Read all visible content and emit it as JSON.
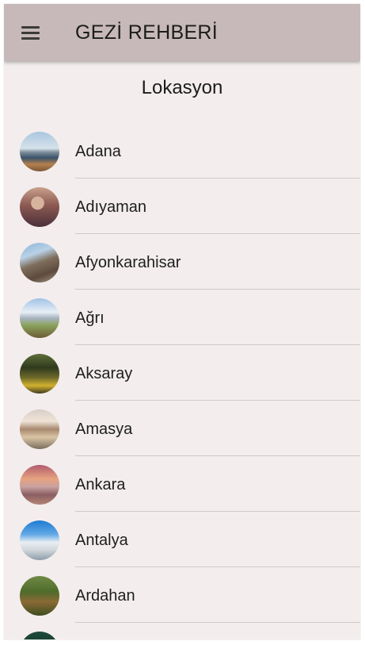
{
  "app": {
    "title": "GEZİ REHBERİ",
    "menu_icon": "hamburger-menu-icon"
  },
  "page": {
    "section_title": "Lokasyon"
  },
  "locations": [
    {
      "label": "Adana",
      "thumb": "adana-thumbnail"
    },
    {
      "label": "Adıyaman",
      "thumb": "adiyaman-thumbnail"
    },
    {
      "label": "Afyonkarahisar",
      "thumb": "afyonkarahisar-thumbnail"
    },
    {
      "label": "Ağrı",
      "thumb": "agri-thumbnail"
    },
    {
      "label": "Aksaray",
      "thumb": "aksaray-thumbnail"
    },
    {
      "label": "Amasya",
      "thumb": "amasya-thumbnail"
    },
    {
      "label": "Ankara",
      "thumb": "ankara-thumbnail"
    },
    {
      "label": "Antalya",
      "thumb": "antalya-thumbnail"
    },
    {
      "label": "Ardahan",
      "thumb": "ardahan-thumbnail"
    }
  ],
  "colors": {
    "appbar": "#c7b9b9",
    "background": "#f3eded",
    "divider": "#cfcaca",
    "text": "#1e1e1e"
  }
}
